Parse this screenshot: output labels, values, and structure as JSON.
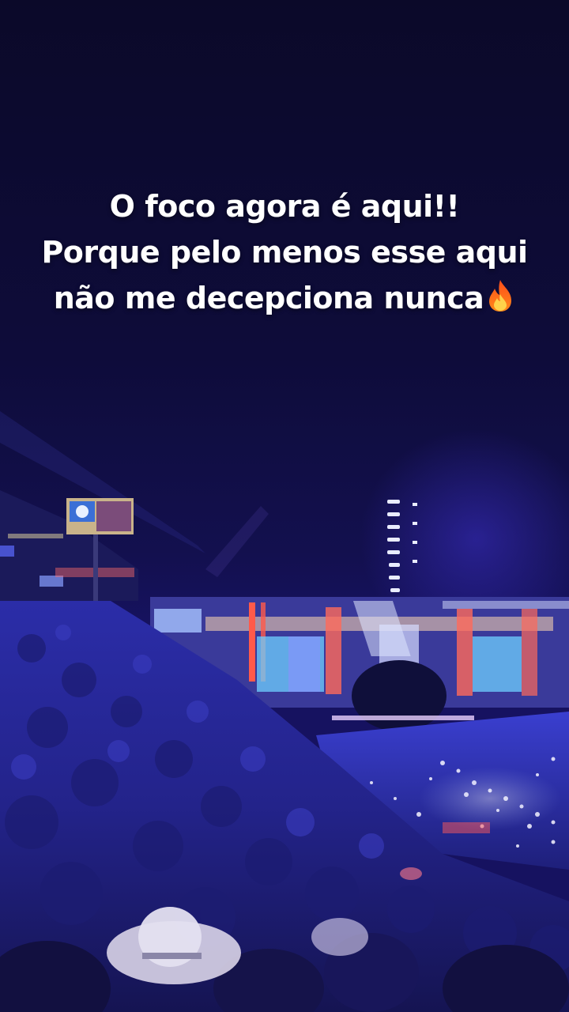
{
  "story": {
    "caption_lines": [
      "O foco agora é aqui!!",
      "Porque pelo menos esse aqui",
      "não me decepciona nunca"
    ],
    "caption_trailing_icon": "fire-icon"
  },
  "colors": {
    "sky_top": "#0c0a2e",
    "sky_mid": "#131052",
    "crowd": "#2a2c9e",
    "stage_light": "#f0e6ff",
    "accent_red": "#ff3b3b",
    "text": "#ffffff"
  }
}
